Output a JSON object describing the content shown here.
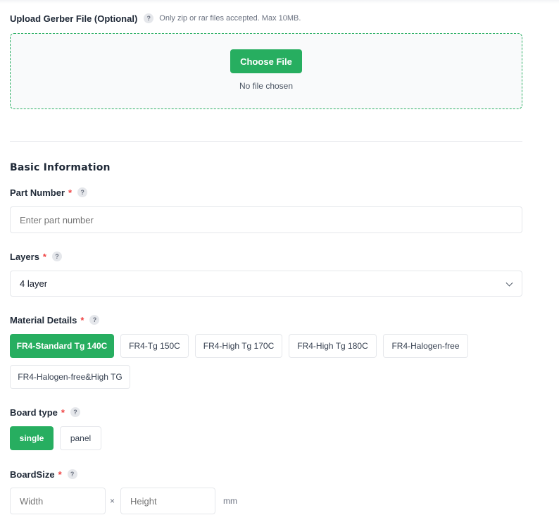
{
  "upload": {
    "label": "Upload Gerber File (Optional)",
    "help": "?",
    "hint": "Only zip or rar files accepted. Max 10MB.",
    "button": "Choose File",
    "status": "No file chosen"
  },
  "section_title": "Basic Information",
  "part_number": {
    "label": "Part Number",
    "required": "*",
    "help": "?",
    "placeholder": "Enter part number"
  },
  "layers": {
    "label": "Layers",
    "required": "*",
    "help": "?",
    "value": "4 layer"
  },
  "material": {
    "label": "Material Details",
    "required": "*",
    "help": "?",
    "options": [
      "FR4-Standard Tg 140C",
      "FR4-Tg 150C",
      "FR4-High Tg 170C",
      "FR4-High Tg 180C",
      "FR4-Halogen-free",
      "FR4-Halogen-free&High TG"
    ],
    "selected": "FR4-Standard Tg 140C"
  },
  "board_type": {
    "label": "Board type",
    "required": "*",
    "help": "?",
    "options": [
      "single",
      "panel"
    ],
    "selected": "single"
  },
  "board_size": {
    "label": "BoardSize",
    "required": "*",
    "help": "?",
    "width_placeholder": "Width",
    "separator": "×",
    "height_placeholder": "Height",
    "unit": "mm"
  },
  "colors": {
    "accent": "#27ae60",
    "required": "#ef4444"
  }
}
